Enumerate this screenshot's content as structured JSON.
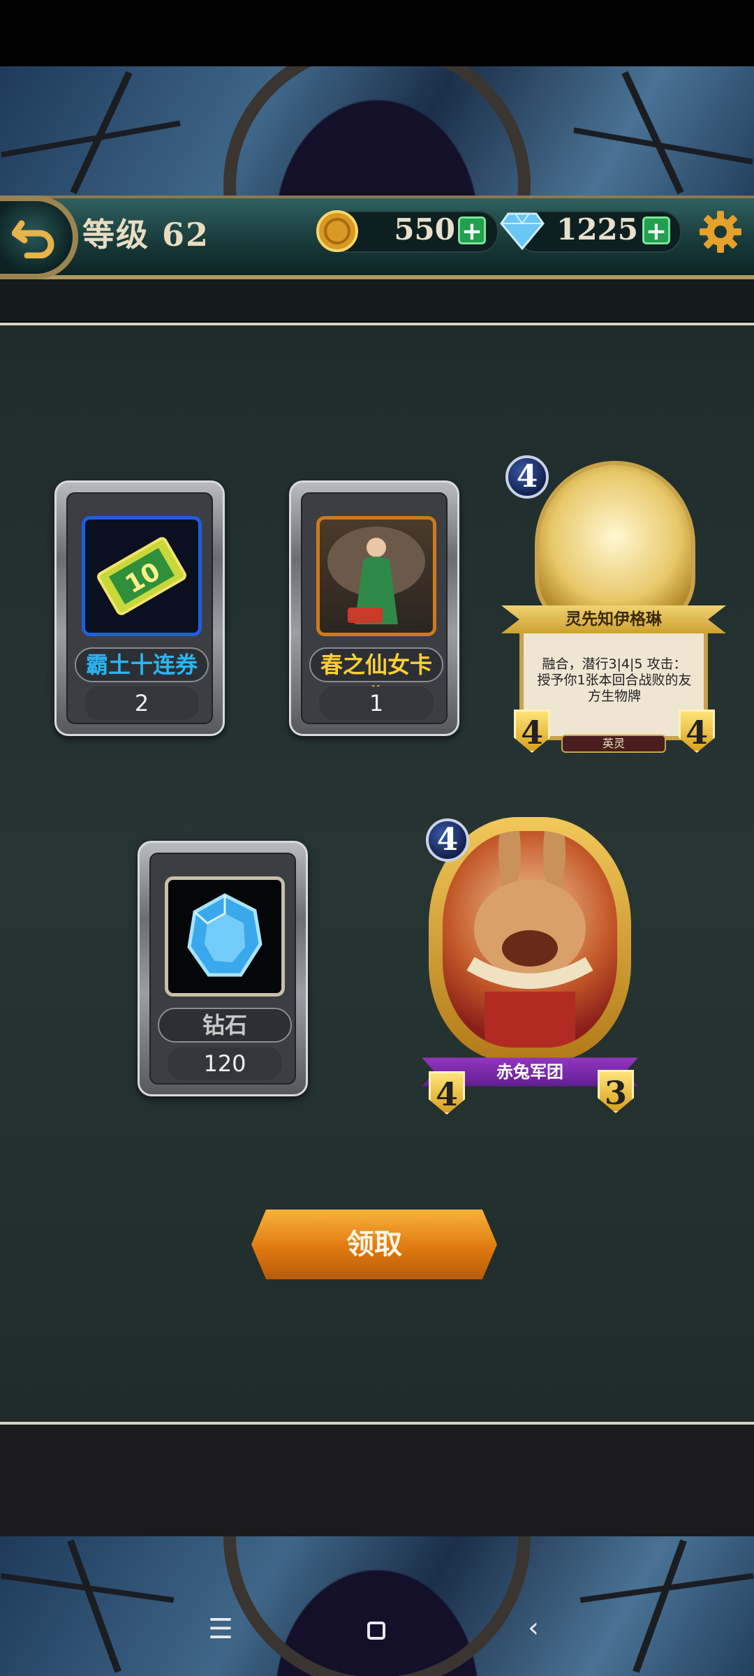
{
  "header": {
    "level_label": "等级 62",
    "gold": "550",
    "diamonds": "1225"
  },
  "rewards": [
    {
      "name": "霸土十连券",
      "count": "2",
      "name_color": "#29b6f6"
    },
    {
      "name": "春之仙女卡背",
      "count": "1",
      "name_color": "#ffcf33"
    },
    {
      "name": "钻石",
      "count": "120",
      "name_color": "#c8c8c8"
    }
  ],
  "cards": [
    {
      "cost": "4",
      "name": "灵先知伊格琳",
      "text": "融合，潜行3|4|5 攻击：授予你1张本回合战败的友方生物牌",
      "attack": "4",
      "health": "4",
      "type": "英灵"
    },
    {
      "cost": "4",
      "name": "赤兔军团",
      "attack": "4",
      "health": "3"
    }
  ],
  "claim_button": "领取",
  "colors": {
    "accent_gold": "#e59a1c",
    "teal_bar": "#1f4a4a",
    "plus_green": "#21a050"
  },
  "icons": [
    "back-arrow-icon",
    "gold-coin-icon",
    "diamond-icon",
    "gear-icon",
    "ticket-icon",
    "blue-gem-icon",
    "menu-icon",
    "home-icon",
    "back-icon"
  ]
}
